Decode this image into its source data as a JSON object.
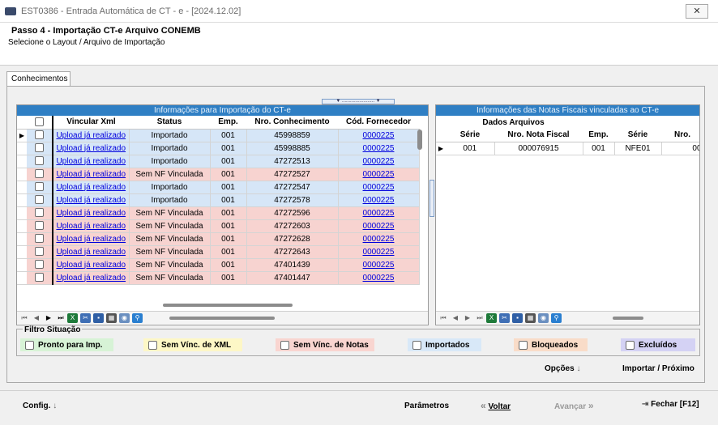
{
  "window": {
    "title": "EST0386 - Entrada Automática de CT - e - [2024.12.02]",
    "close_label": "✕"
  },
  "header": {
    "title": "Passo 4 - Importação CT-e Arquivo CONEMB",
    "subtitle": "Selecione o Layout / Arquivo de Importação"
  },
  "tabs": [
    {
      "label": "Conhecimentos"
    }
  ],
  "left_grid": {
    "title": "Informações para Importação do CT-e",
    "columns": [
      "Vincular Xml",
      "Status",
      "Emp.",
      "Nro. Conhecimento",
      "Cód. Fornecedor"
    ],
    "rows": [
      {
        "link": "Upload já realizado",
        "status": "Importado",
        "emp": "001",
        "nro": "45998859",
        "forn": "0000225",
        "color": "blue"
      },
      {
        "link": "Upload já realizado",
        "status": "Importado",
        "emp": "001",
        "nro": "45998885",
        "forn": "0000225",
        "color": "blue"
      },
      {
        "link": "Upload já realizado",
        "status": "Importado",
        "emp": "001",
        "nro": "47272513",
        "forn": "0000225",
        "color": "blue"
      },
      {
        "link": "Upload já realizado",
        "status": "Sem NF Vinculada",
        "emp": "001",
        "nro": "47272527",
        "forn": "0000225",
        "color": "pink"
      },
      {
        "link": "Upload já realizado",
        "status": "Importado",
        "emp": "001",
        "nro": "47272547",
        "forn": "0000225",
        "color": "blue"
      },
      {
        "link": "Upload já realizado",
        "status": "Importado",
        "emp": "001",
        "nro": "47272578",
        "forn": "0000225",
        "color": "blue"
      },
      {
        "link": "Upload já realizado",
        "status": "Sem NF Vinculada",
        "emp": "001",
        "nro": "47272596",
        "forn": "0000225",
        "color": "pink"
      },
      {
        "link": "Upload já realizado",
        "status": "Sem NF Vinculada",
        "emp": "001",
        "nro": "47272603",
        "forn": "0000225",
        "color": "pink"
      },
      {
        "link": "Upload já realizado",
        "status": "Sem NF Vinculada",
        "emp": "001",
        "nro": "47272628",
        "forn": "0000225",
        "color": "pink"
      },
      {
        "link": "Upload já realizado",
        "status": "Sem NF Vinculada",
        "emp": "001",
        "nro": "47272643",
        "forn": "0000225",
        "color": "pink"
      },
      {
        "link": "Upload já realizado",
        "status": "Sem NF Vinculada",
        "emp": "001",
        "nro": "47401439",
        "forn": "0000225",
        "color": "pink"
      },
      {
        "link": "Upload já realizado",
        "status": "Sem NF Vinculada",
        "emp": "001",
        "nro": "47401447",
        "forn": "0000225",
        "color": "pink"
      }
    ]
  },
  "right_grid": {
    "title": "Informações das Notas Fiscais vinculadas ao CT-e",
    "group_header": "Dados Arquivos",
    "columns": [
      "Série",
      "Nro. Nota Fiscal",
      "Emp.",
      "Série",
      "Nro."
    ],
    "rows": [
      {
        "serie": "001",
        "nota": "000076915",
        "emp": "001",
        "serie2": "NFE01",
        "nro": "00"
      }
    ]
  },
  "filter": {
    "title": "Filtro Situação",
    "options": [
      {
        "label": "Pronto para Imp.",
        "color": "#d7f3d6"
      },
      {
        "label": "Sem Vínc. de XML",
        "color": "#fdf7c6"
      },
      {
        "label": "Sem Vínc. de Notas",
        "color": "#f9d5d0"
      },
      {
        "label": "Importados",
        "color": "#d8e8f8"
      },
      {
        "label": "Bloqueados",
        "color": "#f9dcc8"
      },
      {
        "label": "Excluídos",
        "color": "#d4d2f4"
      }
    ]
  },
  "actions": {
    "opcoes": "Opções",
    "importar": "Importar / Próximo"
  },
  "footer": {
    "config": "Config.",
    "parametros": "Parâmetros",
    "voltar": "Voltar",
    "avancar": "Avançar",
    "fechar": "Fechar [F12]"
  }
}
